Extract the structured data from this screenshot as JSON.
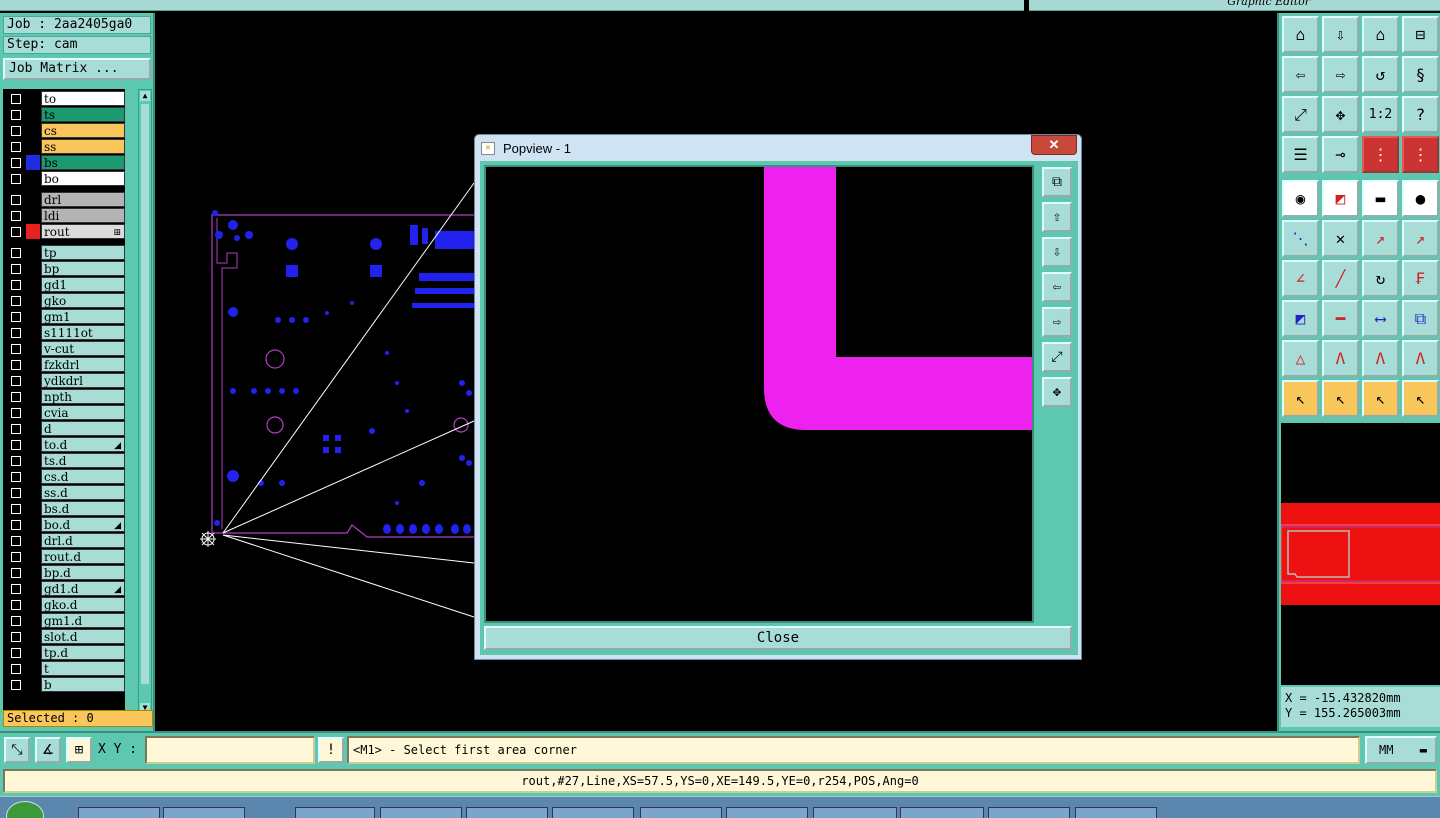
{
  "window": {
    "graphic_editor_title": "Graphic Editor"
  },
  "job": {
    "job_label": "Job : 2aa2405ga0",
    "step_label": "Step: cam",
    "matrix_button": "Job Matrix ..."
  },
  "layers": [
    {
      "name": "to",
      "color": "#ffffff",
      "mark": "",
      "icon": ""
    },
    {
      "name": "ts",
      "color": "#1a9a6e",
      "mark": "",
      "icon": ""
    },
    {
      "name": "cs",
      "color": "#f9c65c",
      "mark": "",
      "icon": ""
    },
    {
      "name": "ss",
      "color": "#f9c65c",
      "mark": "",
      "icon": ""
    },
    {
      "name": "bs",
      "color": "#1a9a6e",
      "mark": "#1f2be0",
      "icon": ""
    },
    {
      "name": "bo",
      "color": "#ffffff",
      "mark": "",
      "icon": ""
    },
    {
      "name": "drl",
      "color": "#b4b4b4",
      "mark": "",
      "icon": ""
    },
    {
      "name": "ldi",
      "color": "#b4b4b4",
      "mark": "",
      "icon": ""
    },
    {
      "name": "rout",
      "color": "#dcdcdc",
      "mark": "#e82020",
      "icon": "⊞"
    },
    {
      "name": "tp",
      "color": "#a8ddd7",
      "mark": "",
      "icon": ""
    },
    {
      "name": "bp",
      "color": "#a8ddd7",
      "mark": "",
      "icon": ""
    },
    {
      "name": "gd1",
      "color": "#a8ddd7",
      "mark": "",
      "icon": ""
    },
    {
      "name": "gko",
      "color": "#a8ddd7",
      "mark": "",
      "icon": ""
    },
    {
      "name": "gm1",
      "color": "#a8ddd7",
      "mark": "",
      "icon": ""
    },
    {
      "name": "s1111ot",
      "color": "#a8ddd7",
      "mark": "",
      "icon": ""
    },
    {
      "name": "v-cut",
      "color": "#a8ddd7",
      "mark": "",
      "icon": ""
    },
    {
      "name": "fzkdrl",
      "color": "#a8ddd7",
      "mark": "",
      "icon": ""
    },
    {
      "name": "ydkdrl",
      "color": "#a8ddd7",
      "mark": "",
      "icon": ""
    },
    {
      "name": "npth",
      "color": "#a8ddd7",
      "mark": "",
      "icon": ""
    },
    {
      "name": "cvia",
      "color": "#a8ddd7",
      "mark": "",
      "icon": ""
    },
    {
      "name": "d",
      "color": "#a8ddd7",
      "mark": "",
      "icon": ""
    },
    {
      "name": "to.d",
      "color": "#a8ddd7",
      "mark": "",
      "icon": "◢"
    },
    {
      "name": "ts.d",
      "color": "#a8ddd7",
      "mark": "",
      "icon": ""
    },
    {
      "name": "cs.d",
      "color": "#a8ddd7",
      "mark": "",
      "icon": ""
    },
    {
      "name": "ss.d",
      "color": "#a8ddd7",
      "mark": "",
      "icon": ""
    },
    {
      "name": "bs.d",
      "color": "#a8ddd7",
      "mark": "",
      "icon": ""
    },
    {
      "name": "bo.d",
      "color": "#a8ddd7",
      "mark": "",
      "icon": "◢"
    },
    {
      "name": "drl.d",
      "color": "#a8ddd7",
      "mark": "",
      "icon": ""
    },
    {
      "name": "rout.d",
      "color": "#a8ddd7",
      "mark": "",
      "icon": ""
    },
    {
      "name": "bp.d",
      "color": "#a8ddd7",
      "mark": "",
      "icon": ""
    },
    {
      "name": "gd1.d",
      "color": "#a8ddd7",
      "mark": "",
      "icon": "◢"
    },
    {
      "name": "gko.d",
      "color": "#a8ddd7",
      "mark": "",
      "icon": ""
    },
    {
      "name": "gm1.d",
      "color": "#a8ddd7",
      "mark": "",
      "icon": ""
    },
    {
      "name": "slot.d",
      "color": "#a8ddd7",
      "mark": "",
      "icon": ""
    },
    {
      "name": "tp.d",
      "color": "#a8ddd7",
      "mark": "",
      "icon": ""
    },
    {
      "name": "t",
      "color": "#a8ddd7",
      "mark": "",
      "icon": ""
    },
    {
      "name": "b",
      "color": "#a8ddd7",
      "mark": "",
      "icon": ""
    }
  ],
  "selected": "Selected : 0",
  "popview": {
    "title": "Popview - 1",
    "close_glyph": "✕",
    "close_button": "Close"
  },
  "coords": {
    "x": "X = -15.432820mm",
    "y": "Y = 155.265003mm"
  },
  "command": {
    "xy_label": "X Y :",
    "xy_value": "",
    "bang": "!",
    "prompt": "<M1> - Select first area corner",
    "unit": "MM"
  },
  "status": "rout,#27,Line,XS=57.5,YS=0,XE=149.5,YE=0,r254,POS,Ang=0",
  "colors": {
    "panel": "#5ec7b0",
    "pad_blue": "#2222ee",
    "rout_magenta": "#ee22ee",
    "profile": "#b040c0"
  }
}
